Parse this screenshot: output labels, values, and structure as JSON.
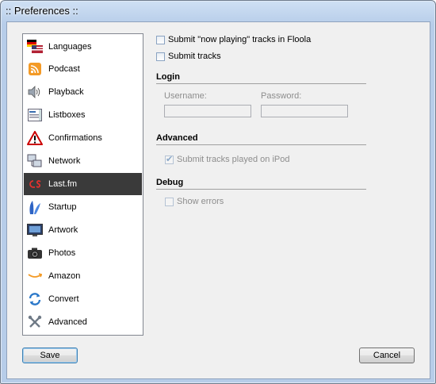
{
  "window": {
    "title": ":: Preferences ::"
  },
  "sidebar": {
    "items": [
      {
        "label": "Languages",
        "icon": "flags-icon"
      },
      {
        "label": "Podcast",
        "icon": "rss-icon"
      },
      {
        "label": "Playback",
        "icon": "speaker-icon"
      },
      {
        "label": "Listboxes",
        "icon": "listbox-icon"
      },
      {
        "label": "Confirmations",
        "icon": "warning-icon"
      },
      {
        "label": "Network",
        "icon": "network-icon"
      },
      {
        "label": "Last.fm",
        "icon": "lastfm-icon",
        "selected": true
      },
      {
        "label": "Startup",
        "icon": "startup-icon"
      },
      {
        "label": "Artwork",
        "icon": "artwork-icon"
      },
      {
        "label": "Photos",
        "icon": "camera-icon"
      },
      {
        "label": "Amazon",
        "icon": "amazon-icon"
      },
      {
        "label": "Convert",
        "icon": "convert-icon"
      },
      {
        "label": "Advanced",
        "icon": "tools-icon"
      }
    ]
  },
  "main": {
    "now_playing_label": "Submit \"now playing\" tracks in Floola",
    "submit_tracks_label": "Submit tracks",
    "login": {
      "heading": "Login",
      "username_label": "Username:",
      "password_label": "Password:",
      "username_value": "",
      "password_value": ""
    },
    "advanced": {
      "heading": "Advanced",
      "ipod_label": "Submit tracks played on iPod",
      "ipod_checked": true
    },
    "debug": {
      "heading": "Debug",
      "show_errors_label": "Show errors"
    }
  },
  "footer": {
    "save_label": "Save",
    "cancel_label": "Cancel"
  }
}
